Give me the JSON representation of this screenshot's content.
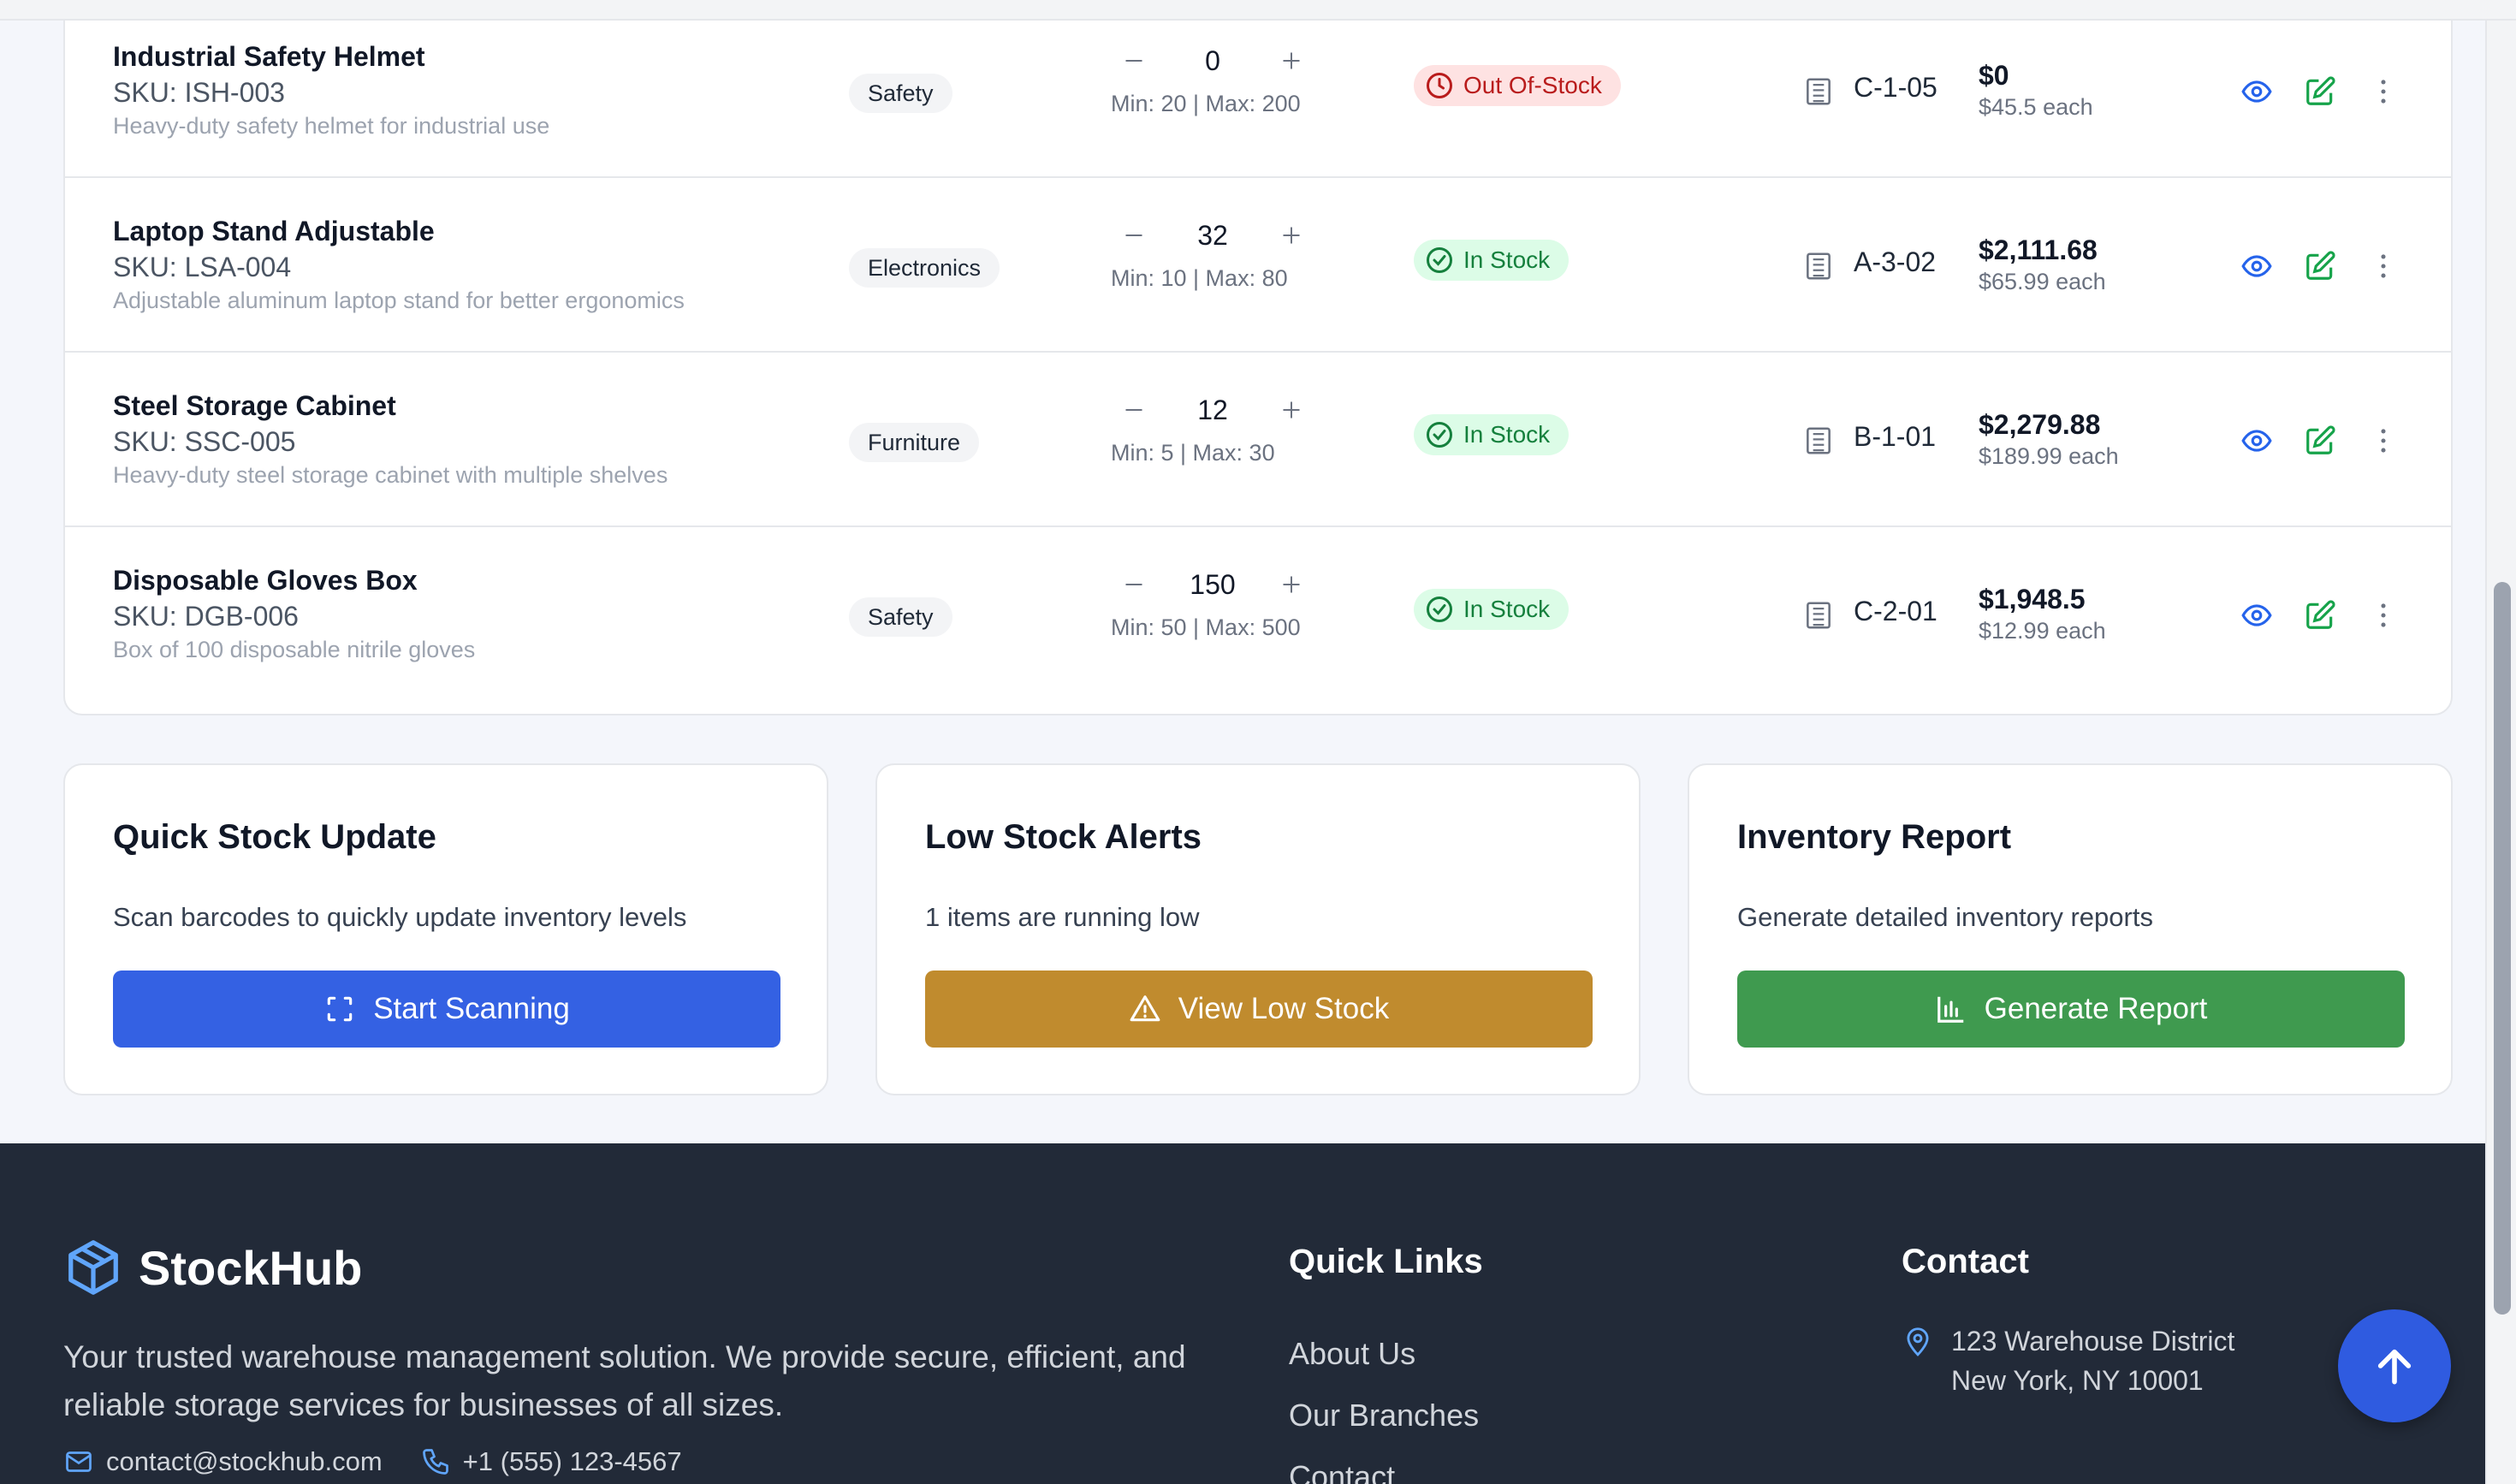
{
  "inventory": {
    "rows": [
      {
        "name": "Industrial Safety Helmet",
        "sku": "SKU: ISH-003",
        "desc": "Heavy-duty safety helmet for industrial use",
        "category": "Safety",
        "qty": "0",
        "range": "Min: 20 | Max: 200",
        "status": "Out Of-Stock",
        "location": "C-1-05",
        "total": "$0",
        "each": "$45.5 each"
      },
      {
        "name": "Laptop Stand Adjustable",
        "sku": "SKU: LSA-004",
        "desc": "Adjustable aluminum laptop stand for better ergonomics",
        "category": "Electronics",
        "qty": "32",
        "range": "Min: 10 | Max: 80",
        "status": "In Stock",
        "location": "A-3-02",
        "total": "$2,111.68",
        "each": "$65.99 each"
      },
      {
        "name": "Steel Storage Cabinet",
        "sku": "SKU: SSC-005",
        "desc": "Heavy-duty steel storage cabinet with multiple shelves",
        "category": "Furniture",
        "qty": "12",
        "range": "Min: 5 | Max: 30",
        "status": "In Stock",
        "location": "B-1-01",
        "total": "$2,279.88",
        "each": "$189.99 each"
      },
      {
        "name": "Disposable Gloves Box",
        "sku": "SKU: DGB-006",
        "desc": "Box of 100 disposable nitrile gloves",
        "category": "Safety",
        "qty": "150",
        "range": "Min: 50 | Max: 500",
        "status": "In Stock",
        "location": "C-2-01",
        "total": "$1,948.5",
        "each": "$12.99 each"
      }
    ],
    "icons": {
      "decrement": "minus-icon",
      "increment": "plus-icon",
      "view": "eye-icon",
      "edit": "edit-icon",
      "more": "more-vertical-icon",
      "location": "building-icon"
    }
  },
  "cards": {
    "scan": {
      "title": "Quick Stock Update",
      "text": "Scan barcodes to quickly update inventory levels",
      "button": "Start Scanning",
      "color": "#3461e3"
    },
    "alerts": {
      "title": "Low Stock Alerts",
      "text": "1 items are running low",
      "button": "View Low Stock",
      "color": "#c08b2e"
    },
    "report": {
      "title": "Inventory Report",
      "text": "Generate detailed inventory reports",
      "button": "Generate Report",
      "color": "#3f9a4f"
    }
  },
  "footer": {
    "brand": "StockHub",
    "tagline": "Your trusted warehouse management solution. We provide secure, efficient, and reliable storage services for businesses of all sizes.",
    "email": "contact@stockhub.com",
    "phone": "+1 (555) 123-4567",
    "quick_links_title": "Quick Links",
    "links": [
      "About Us",
      "Our Branches",
      "Contact"
    ],
    "contact_title": "Contact",
    "address_line1": "123 Warehouse District",
    "address_line2": "New York, NY 10001"
  },
  "colors": {
    "footer_bg": "#222a38",
    "in_stock_bg": "#dcfce7",
    "out_stock_bg": "#fee2e2",
    "accent_blue": "#2f5be0"
  }
}
